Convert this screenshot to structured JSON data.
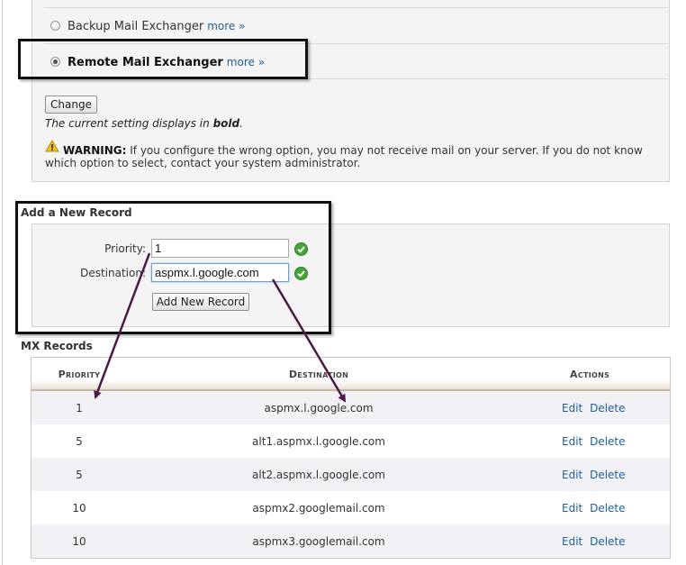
{
  "exchanger_options": {
    "backup": {
      "label": "Backup Mail Exchanger",
      "more": "more »",
      "selected": false
    },
    "remote": {
      "label": "Remote Mail Exchanger",
      "more": "more »",
      "selected": true
    }
  },
  "change_button": "Change",
  "current_setting_note": {
    "prefix": "The current setting displays in ",
    "emphasis": "bold",
    "suffix": "."
  },
  "warning": {
    "icon": "warning-triangle-icon",
    "label": "WARNING:",
    "text": " If you configure the wrong option, you may not receive mail on your server. If you do not know which option to select, contact your system administrator."
  },
  "add_record": {
    "title": "Add a New Record",
    "priority_label": "Priority:",
    "priority_value": "1",
    "destination_label": "Destination:",
    "destination_value": "aspmx.l.google.com",
    "submit_label": "Add New Record",
    "valid_icon": "green-check-icon"
  },
  "mx_records": {
    "title": "MX Records",
    "headers": {
      "priority": "Priority",
      "destination": "Destination",
      "actions": "Actions"
    },
    "action_labels": {
      "edit": "Edit",
      "delete": "Delete"
    },
    "rows": [
      {
        "priority": "1",
        "destination": "aspmx.l.google.com"
      },
      {
        "priority": "5",
        "destination": "alt1.aspmx.l.google.com"
      },
      {
        "priority": "5",
        "destination": "alt2.aspmx.l.google.com"
      },
      {
        "priority": "10",
        "destination": "aspmx2.googlemail.com"
      },
      {
        "priority": "10",
        "destination": "aspmx3.googlemail.com"
      }
    ]
  },
  "colors": {
    "link": "#1f5f99",
    "highlight_frame": "#111111",
    "annotation_arrow": "#4a1a45",
    "valid_green": "#49a33b"
  }
}
